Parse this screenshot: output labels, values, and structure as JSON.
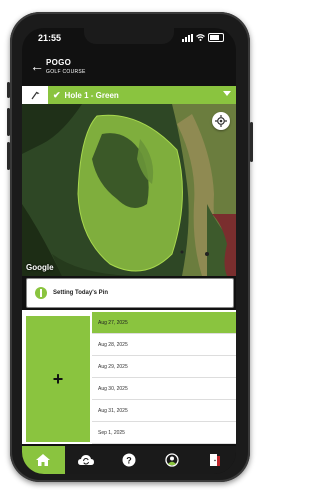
{
  "status": {
    "time": "21:55"
  },
  "header": {
    "course_name": "POGO",
    "course_subtitle": "GOLF COURSE"
  },
  "hole_selector": {
    "label": "Hole 1 - Green"
  },
  "map": {
    "attribution": "Google"
  },
  "pin_card": {
    "label": "Setting Today's Pin"
  },
  "add_button": {
    "label": "+"
  },
  "dates": [
    {
      "label": "Aug 27, 2025",
      "selected": true
    },
    {
      "label": "Aug 28, 2025",
      "selected": false
    },
    {
      "label": "Aug 29, 2025",
      "selected": false
    },
    {
      "label": "Aug 30, 2025",
      "selected": false
    },
    {
      "label": "Aug 31, 2025",
      "selected": false
    },
    {
      "label": "Sep 1, 2025",
      "selected": false
    }
  ],
  "tabs": [
    {
      "icon": "home-icon",
      "active": true
    },
    {
      "icon": "cloud-sync-icon",
      "active": false
    },
    {
      "icon": "help-icon",
      "active": false
    },
    {
      "icon": "account-icon",
      "active": false
    },
    {
      "icon": "logout-icon",
      "active": false
    }
  ],
  "colors": {
    "accent": "#8ac43f",
    "background": "#111111"
  }
}
